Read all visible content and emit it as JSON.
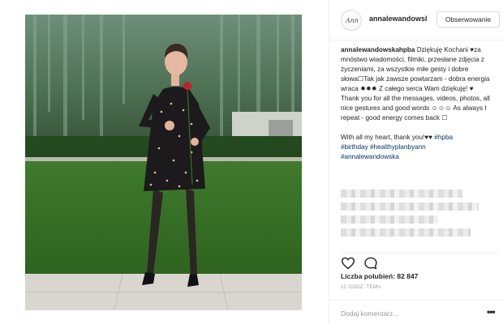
{
  "post": {
    "username": "annalewandowsl",
    "follow_label": "Obserwowanie",
    "avatar_text": "Ann",
    "caption": {
      "author": "annalewandowskahpba",
      "text_pl": " Dziękuję Kochani ♥za mnóstwo wiadomości, filmiki, przesłane zdjęcia z życzeniami, za wszystkie miłe gesty i dobre słowa☐Tak jak zawsze powtarzam - dobra energia wraca ✹✹✹ Z całego serca Wam dziękuję! ♥",
      "text_en": "Thank you for all the messages, videos, photos, all nice gestures and good words ☺☺☺ As always I repeat - good energy comes back ☐",
      "closing": "With all my heart, thank you!♥♥ ",
      "tags": [
        "#hpba",
        "#birthday",
        "#healthyplanbyann",
        "#annalewandowska"
      ]
    },
    "likes_label": "Liczba polubień: 82 847",
    "timestamp": "12 GODZ. TEMU",
    "comment_placeholder": "Dodaj komentarz...",
    "more_glyph": "•••"
  },
  "icons": [
    "heart-icon",
    "comment-icon"
  ],
  "colors": {
    "link": "#003569",
    "border": "#efefef",
    "muted": "#999999"
  }
}
